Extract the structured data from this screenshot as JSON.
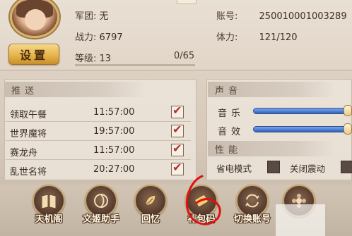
{
  "profile": {
    "legion_label": "军团:",
    "legion_value": "无",
    "power_label": "战力:",
    "power_value": "6797",
    "level_label": "等级:",
    "level_value": "13",
    "xp_text": "0/65",
    "xp_progress": 0,
    "account_label": "账号:",
    "account_value": "250010001003289",
    "stamina_label": "体力:",
    "stamina_value": "121/120",
    "settings_label": "设置"
  },
  "push": {
    "title": "推送",
    "items": [
      {
        "name": "领取午餐",
        "time": "11:57:00",
        "checked": true
      },
      {
        "name": "世界魔将",
        "time": "19:57:00",
        "checked": true
      },
      {
        "name": "赛龙舟",
        "time": "11:57:00",
        "checked": true
      },
      {
        "name": "乱世名将",
        "time": "20:27:00",
        "checked": true
      }
    ]
  },
  "sound": {
    "title": "声音",
    "music_label": "音乐",
    "music_level": 1.0,
    "effects_label": "音效",
    "effects_level": 1.0
  },
  "performance": {
    "title": "性能",
    "power_saving_label": "省电模式",
    "power_saving_on": false,
    "vibration_label": "关闭震动",
    "vibration_on": false
  },
  "bottom_bar": [
    {
      "label": "天机阁",
      "icon": "book-icon"
    },
    {
      "label": "文姬助手",
      "icon": "swirl-icon"
    },
    {
      "label": "回忆",
      "icon": "leaf-icon"
    },
    {
      "label": "礼包码",
      "icon": "ticket-icon"
    },
    {
      "label": "切换账号",
      "icon": "switch-icon"
    },
    {
      "label": "",
      "icon": "flower-icon"
    }
  ],
  "colors": {
    "accent_gold": "#e6b54b",
    "check_red": "#b52d24",
    "slider_blue": "#4b7ed6",
    "annotation_red": "#e01010"
  }
}
